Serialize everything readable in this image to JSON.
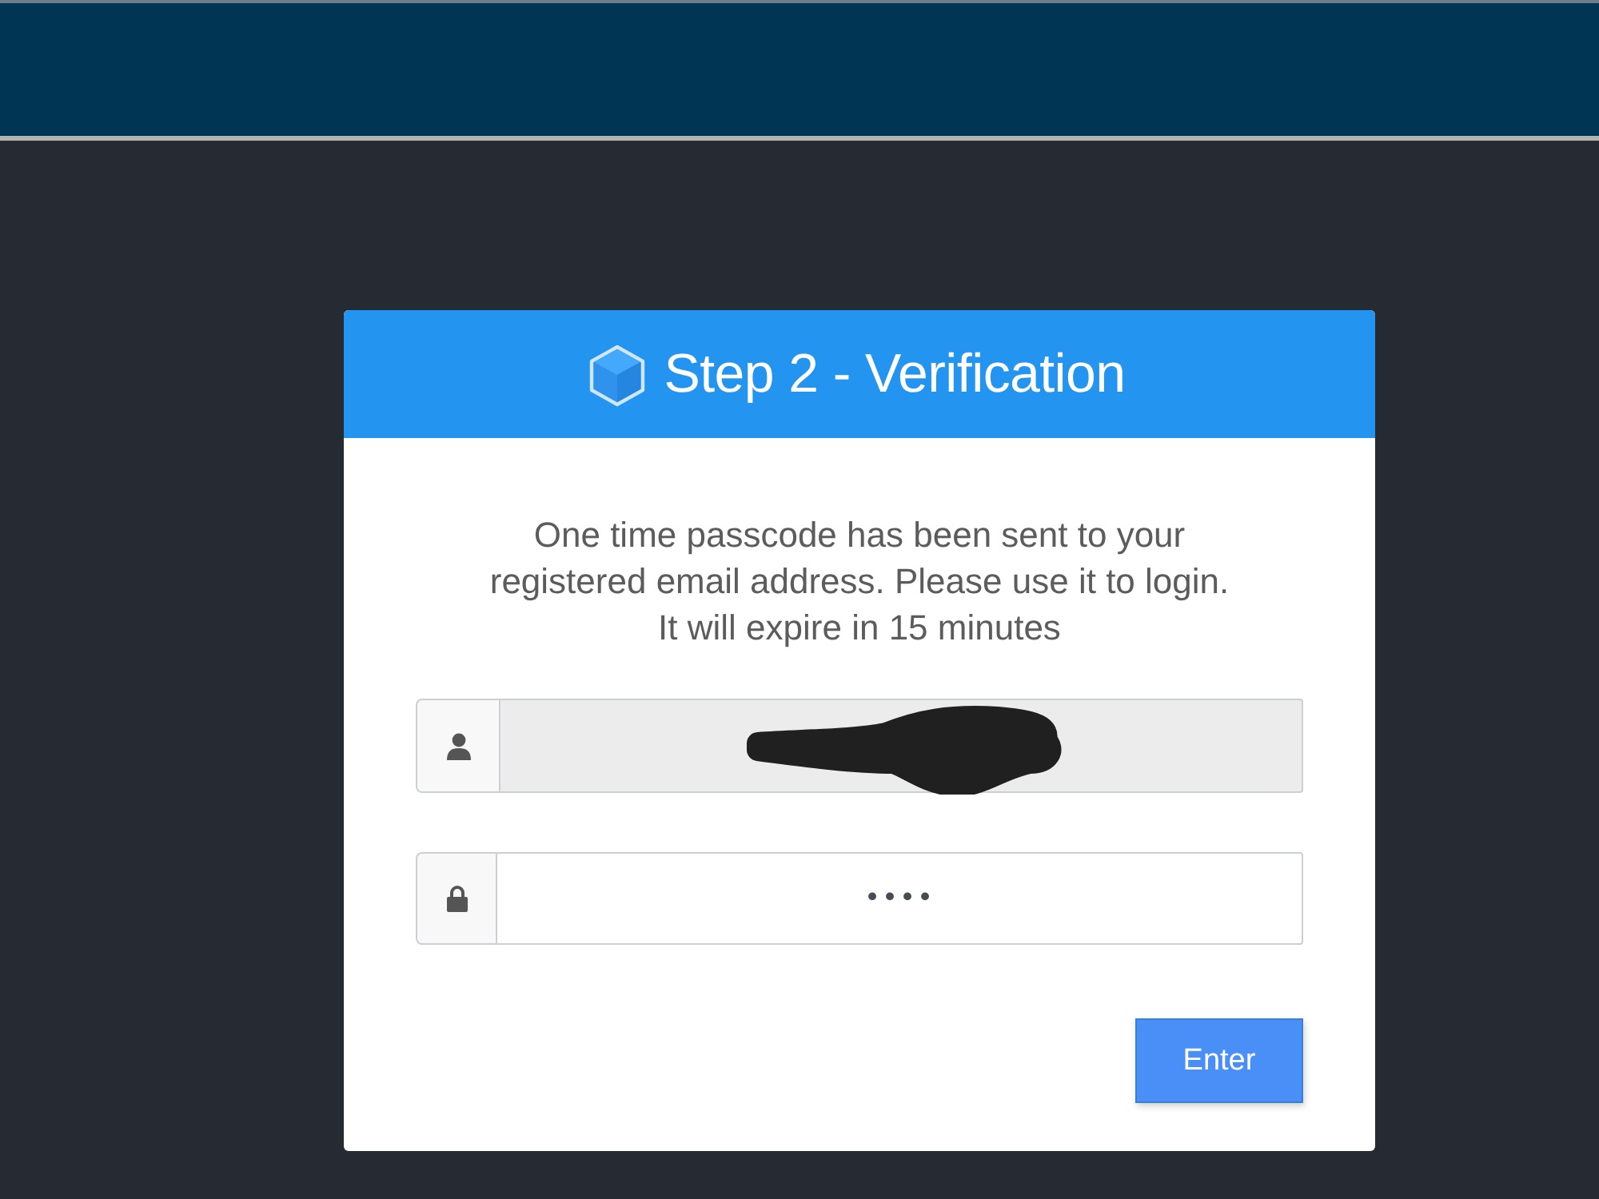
{
  "header": {
    "title": "Step 2 - Verification"
  },
  "message": {
    "lines": [
      "One time passcode has been sent to your",
      "registered email address. Please use it to login.",
      "It will expire in 15 minutes"
    ]
  },
  "username_field": {
    "disabled": true,
    "redacted": true
  },
  "password_field": {
    "value": "••••"
  },
  "submit_button": {
    "label": "Enter"
  }
}
